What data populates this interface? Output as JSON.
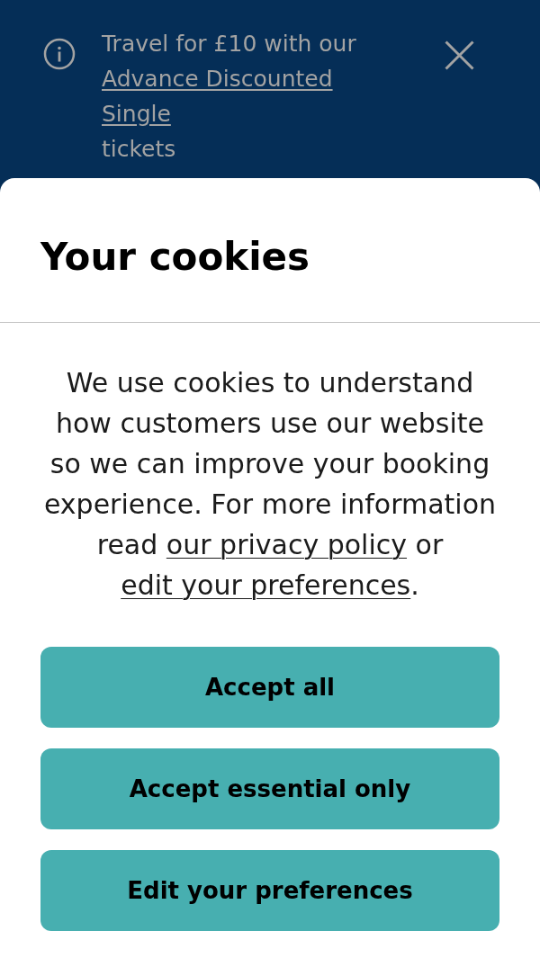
{
  "banner": {
    "message": [
      {
        "kind": "text",
        "text": "Travel for £10 with our"
      },
      {
        "kind": "link",
        "text": "Advance Discounted Single"
      },
      {
        "kind": "text",
        "text": "tickets"
      }
    ]
  },
  "cookie_dialog": {
    "title": "Your cookies",
    "body": [
      {
        "kind": "text",
        "text": "We use cookies to understand how customers use our website so we can improve your booking experience. For more information read "
      },
      {
        "kind": "link",
        "text": "our privacy policy"
      },
      {
        "kind": "text",
        "text": " or "
      },
      {
        "kind": "link",
        "text": "edit your preferences"
      },
      {
        "kind": "text",
        "text": "."
      }
    ],
    "buttons": [
      "Accept all",
      "Accept essential only",
      "Edit your preferences"
    ]
  }
}
